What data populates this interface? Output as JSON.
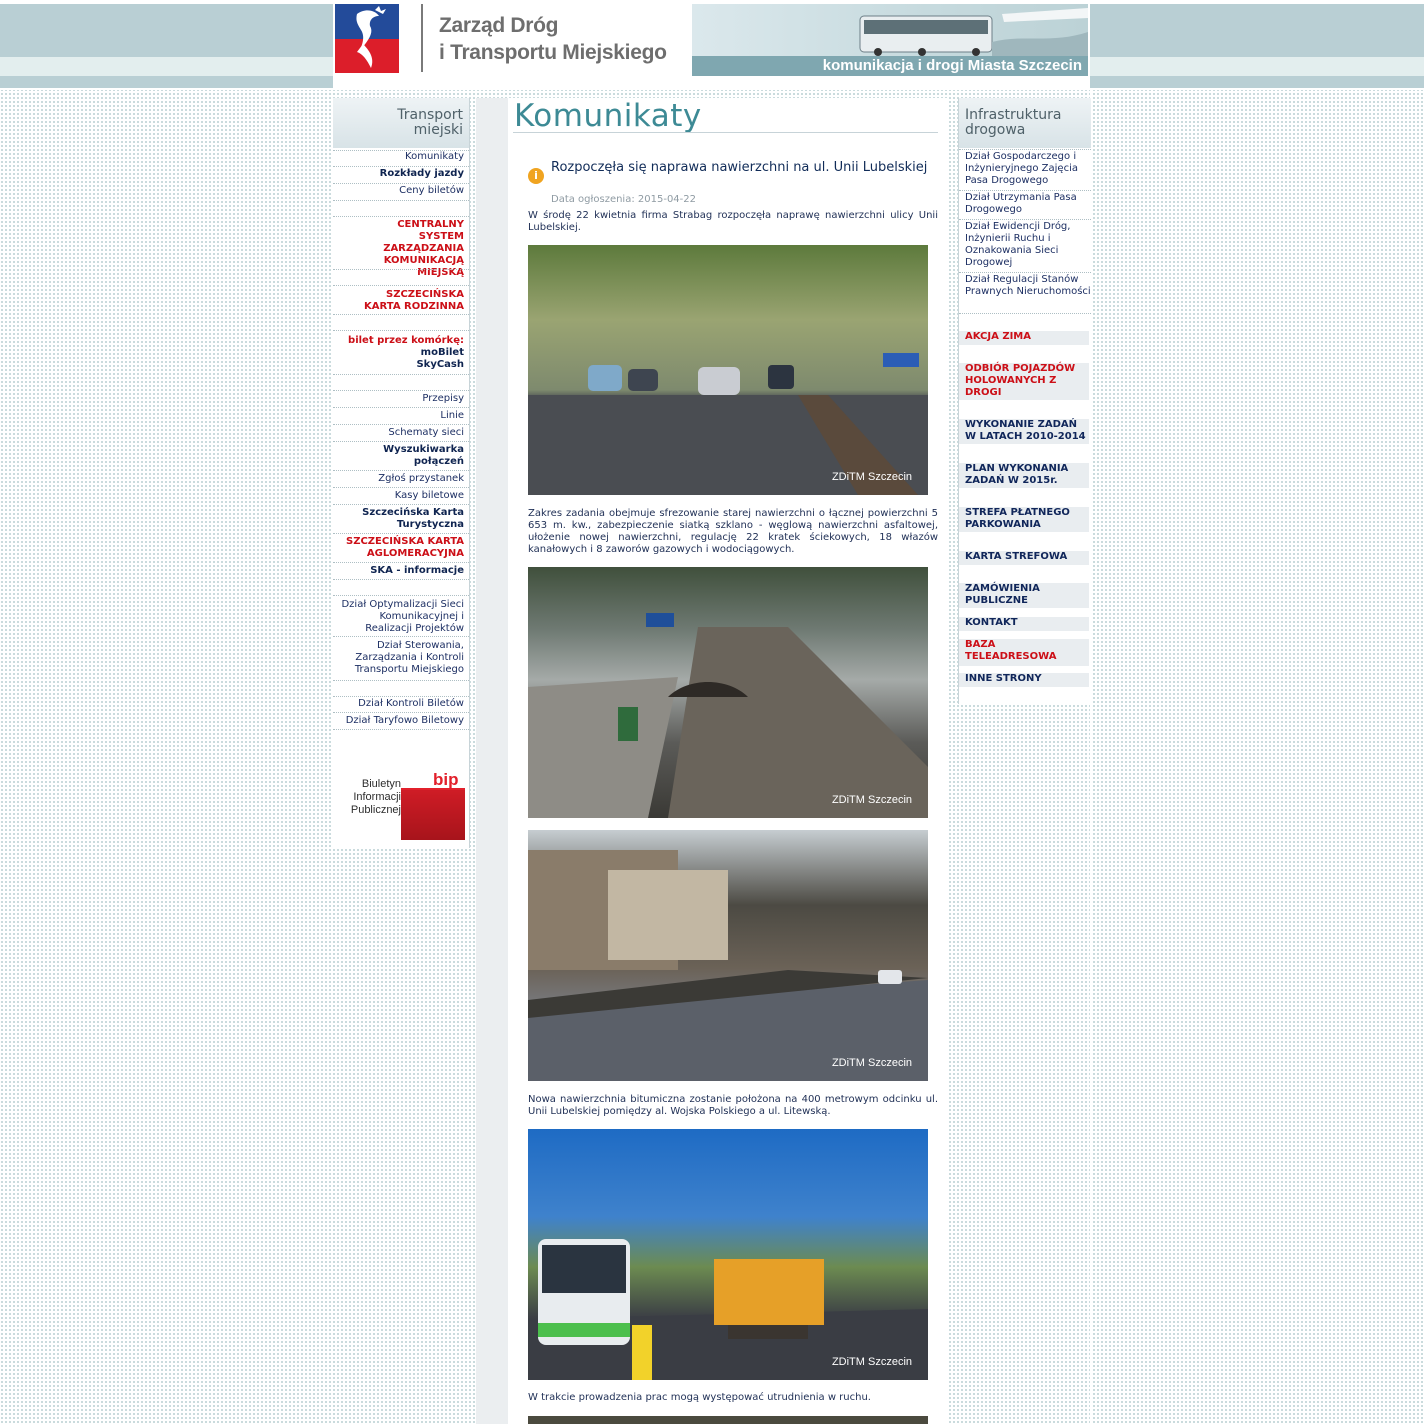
{
  "header": {
    "org_line1": "Zarząd Dróg",
    "org_line2": "i Transportu Miejskiego",
    "tagline": "komunikacja i drogi Miasta Szczecin"
  },
  "left_sidebar": {
    "title_line1": "Transport",
    "title_line2": "miejski",
    "items": [
      "Komunikaty",
      "Rozkłady jazdy",
      "Ceny biletów",
      "CENTRALNY SYSTEM ZARZĄDZANIA KOMUNIKACJĄ MIEJSKĄ",
      "SZCZECIŃSKA KARTA RODZINNA",
      "bilet przez komórkę:",
      "moBilet",
      "SkyCash",
      "Przepisy",
      "Linie",
      "Schematy sieci",
      "Wyszukiwarka połączeń",
      "Zgłoś przystanek",
      "Kasy biletowe",
      "Szczecińska Karta Turystyczna",
      "SZCZECIŃSKA KARTA AGLOMERACYJNA",
      "SKA - informacje",
      "Dział Optymalizacji Sieci Komunikacyjnej i Realizacji Projektów",
      "Dział Sterowania, Zarządzania i Kontroli Transportu Miejskiego",
      "Dział Kontroli Biletów",
      "Dział Taryfowo Biletowy"
    ],
    "bip_text": "Biuletyn Informacji Publicznej",
    "bip_label": "bip"
  },
  "main": {
    "page_title": "Komunikaty",
    "news_title": "Rozpoczęła się naprawa nawierzchni na ul. Unii Lubelskiej",
    "news_date": "Data ogłoszenia: 2015-04-22",
    "paragraphs": [
      "W środę 22 kwietnia firma Strabag rozpoczęła naprawę nawierzchni ulicy Unii Lubelskiej.",
      "Zakres zadania obejmuje sfrezowanie starej nawierzchni o łącznej powierzchni 5 653 m. kw., zabezpieczenie siatką szklano - węglową nawierzchni asfaltowej, ułożenie nowej nawierzchni, regulację 22 kratek ściekowych, 18 włazów kanałowych i 8 zaworów gazowych i wodociągowych.",
      "Nowa nawierzchnia bitumiczna zostanie położona na 400 metrowym odcinku ul. Unii Lubelskiej pomiędzy al. Wojska Polskiego a ul. Litewską.",
      "W trakcie prowadzenia prac mogą występować utrudnienia w ruchu."
    ],
    "photo_caption": "ZDiTM Szczecin"
  },
  "right_sidebar": {
    "title_line1": "Infrastruktura",
    "title_line2": "drogowa",
    "links": [
      "Dział Gospodarczego i Inżynieryjnego Zajęcia Pasa Drogowego",
      "Dział Utrzymania Pasa Drogowego",
      "Dział Ewidencji Dróg, Inżynierii Ruchu i Oznakowania Sieci Drogowej",
      "Dział Regulacji Stanów Prawnych Nieruchomości"
    ],
    "buttons": [
      "AKCJA ZIMA",
      "ODBIÓR POJAZDÓW HOLOWANYCH Z DROGI",
      "WYKONANIE ZADAŃ W LATACH 2010-2014",
      "PLAN WYKONANIA ZADAŃ W 2015r.",
      "STREFA PŁATNEGO PARKOWANIA",
      "KARTA STREFOWA",
      "ZAMÓWIENIA PUBLICZNE",
      "KONTAKT",
      "BAZA TELEADRESOWA",
      "INNE STRONY"
    ]
  },
  "colors": {
    "accent": "#3d8a95",
    "nav_text": "#1d2f63",
    "highlight_red": "#cc0f17",
    "header_blue": "#b9cfd4"
  }
}
